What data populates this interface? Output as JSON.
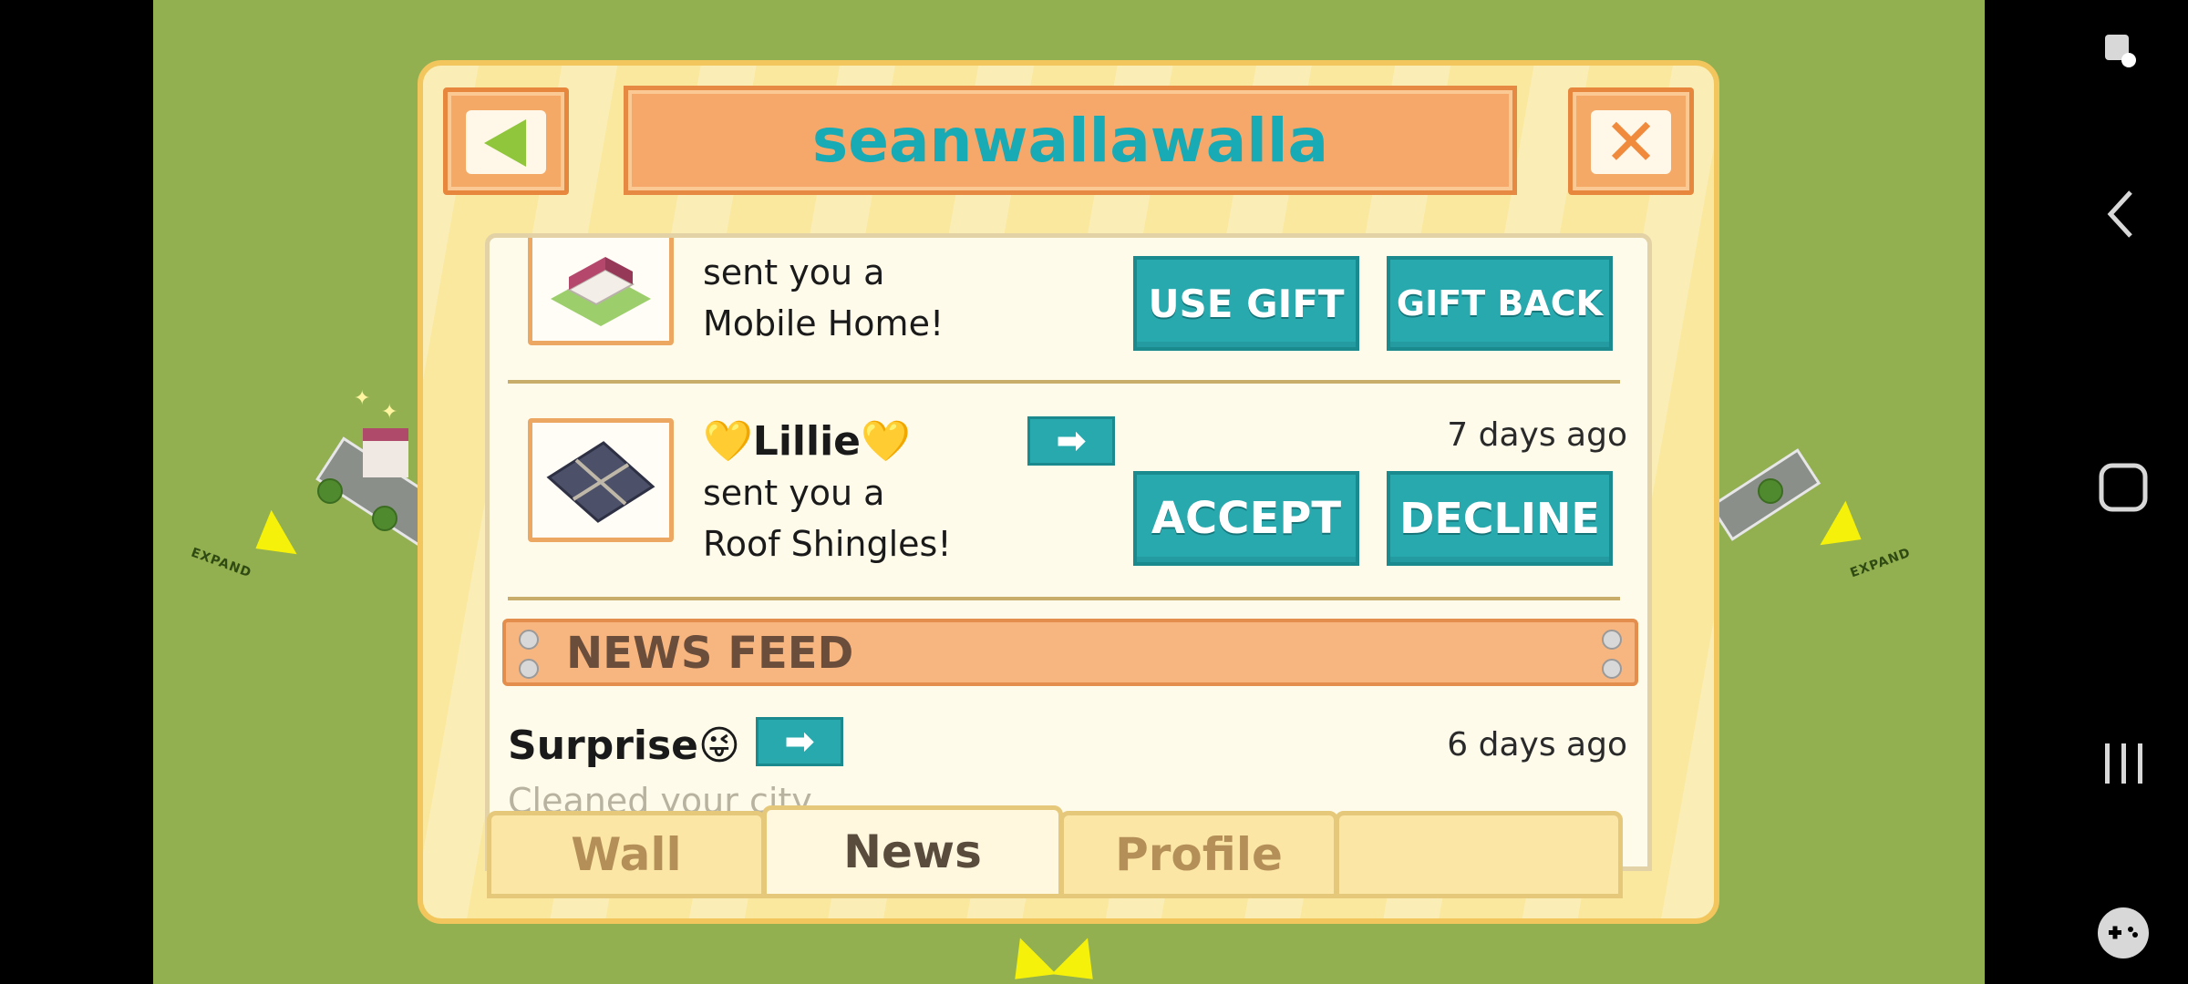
{
  "header": {
    "title": "seanwallawalla"
  },
  "gifts": [
    {
      "message_line1": "sent you a",
      "message_line2": "Mobile Home!",
      "primary_label": "USE GIFT",
      "secondary_label": "GIFT BACK"
    },
    {
      "sender": "💛Lillie💛",
      "time": "7 days ago",
      "message_line1": "sent you a",
      "message_line2": "Roof Shingles!",
      "primary_label": "ACCEPT",
      "secondary_label": "DECLINE"
    }
  ],
  "news_feed": {
    "heading": "NEWS FEED",
    "items": [
      {
        "sender": "Surprise😜",
        "time": "6 days ago",
        "text": "Cleaned your city"
      }
    ]
  },
  "tabs": [
    {
      "label": "Wall",
      "active": false
    },
    {
      "label": "News",
      "active": true
    },
    {
      "label": "Profile",
      "active": false
    }
  ],
  "game": {
    "expand_label": "EXPAND"
  },
  "icons": {
    "back": "green-left-triangle-icon",
    "close": "orange-x-icon",
    "go": "right-arrow-icon",
    "nav": [
      "accessibility-icon",
      "back-chevron-icon",
      "home-square-icon",
      "recents-icon",
      "game-controller-icon"
    ]
  },
  "colors": {
    "teal": "#28a9ae",
    "title_text": "#18aab5",
    "panel": "#f9e89d",
    "orange": "#f6a86a"
  }
}
